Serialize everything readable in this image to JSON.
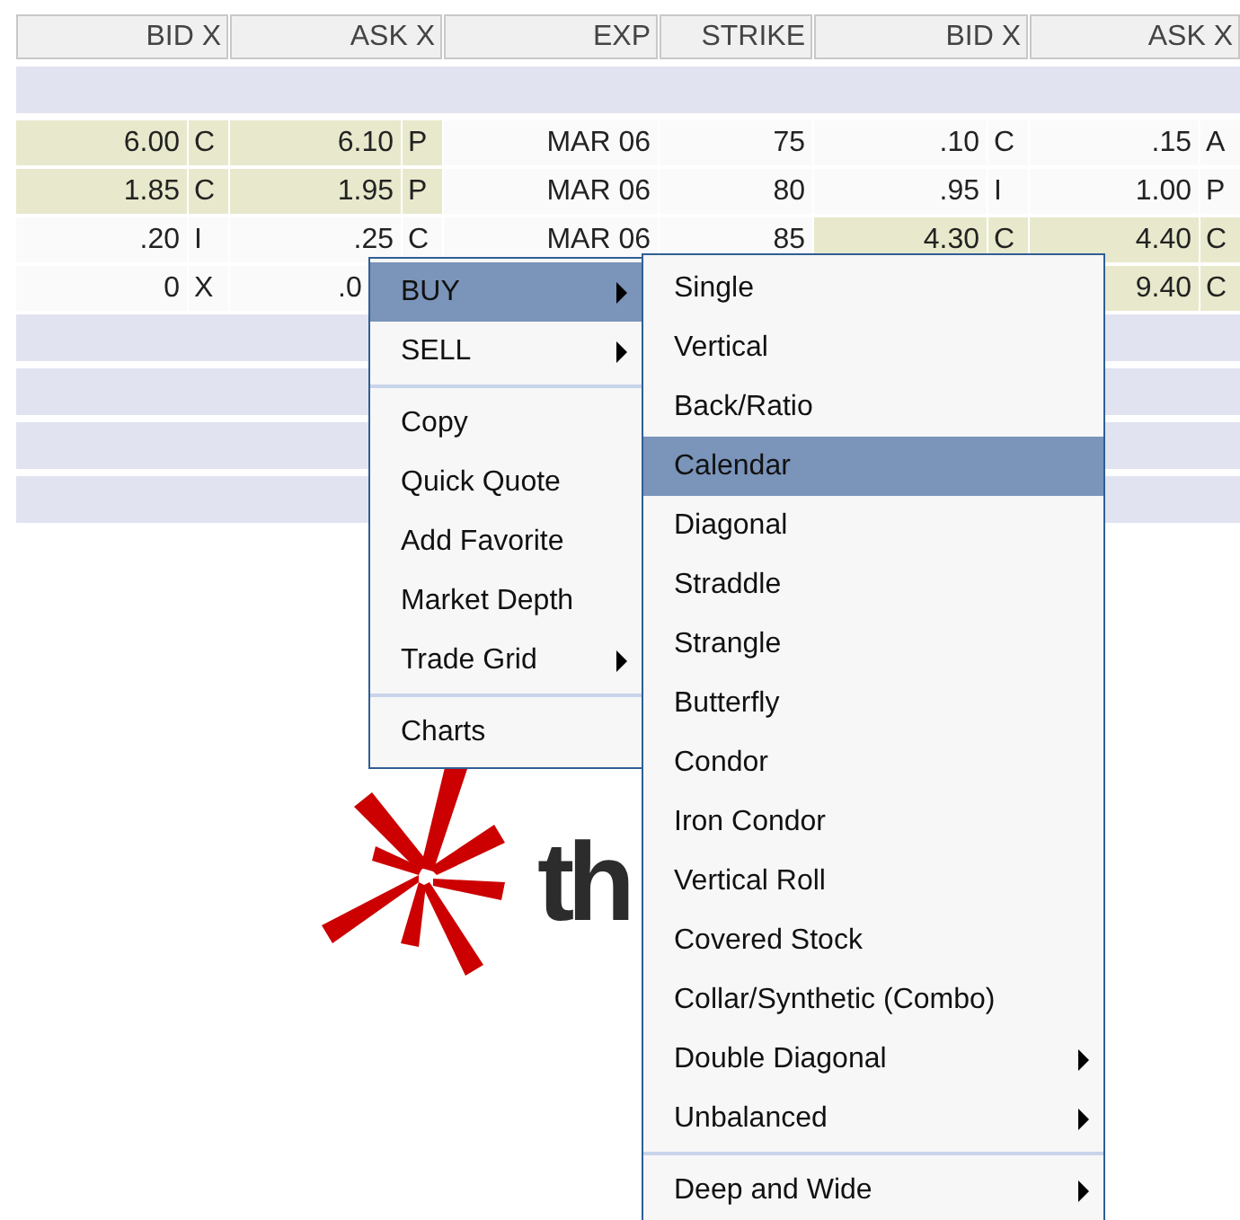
{
  "table": {
    "columns": [
      "BID X",
      "ASK X",
      "EXP",
      "STRIKE",
      "BID X",
      "ASK X"
    ],
    "rows": [
      {
        "kind": "blank"
      },
      {
        "kind": "quote",
        "cells": [
          {
            "text": "6.00",
            "highlighted": true
          },
          {
            "text": "C",
            "highlighted": true
          },
          {
            "text": "6.10",
            "highlighted": true
          },
          {
            "text": "P",
            "highlighted": true
          },
          {
            "text": "MAR 06",
            "highlighted": false
          },
          {
            "text": "75",
            "highlighted": false
          },
          {
            "text": ".10",
            "highlighted": false
          },
          {
            "text": "C",
            "highlighted": false
          },
          {
            "text": ".15",
            "highlighted": false
          },
          {
            "text": "A",
            "highlighted": false
          }
        ]
      },
      {
        "kind": "quote",
        "cells": [
          {
            "text": "1.85",
            "highlighted": true
          },
          {
            "text": "C",
            "highlighted": true
          },
          {
            "text": "1.95",
            "highlighted": true
          },
          {
            "text": "P",
            "highlighted": true
          },
          {
            "text": "MAR 06",
            "highlighted": false
          },
          {
            "text": "80",
            "highlighted": false
          },
          {
            "text": ".95",
            "highlighted": false
          },
          {
            "text": "I",
            "highlighted": false
          },
          {
            "text": "1.00",
            "highlighted": false
          },
          {
            "text": "P",
            "highlighted": false
          }
        ]
      },
      {
        "kind": "quote",
        "cells": [
          {
            "text": ".20",
            "highlighted": false
          },
          {
            "text": "I",
            "highlighted": false
          },
          {
            "text": ".25",
            "highlighted": false
          },
          {
            "text": "C",
            "highlighted": false
          },
          {
            "text": "MAR 06",
            "highlighted": false
          },
          {
            "text": "85",
            "highlighted": false
          },
          {
            "text": "4.30",
            "highlighted": true
          },
          {
            "text": "C",
            "highlighted": true
          },
          {
            "text": "4.40",
            "highlighted": true
          },
          {
            "text": "C",
            "highlighted": true
          }
        ]
      },
      {
        "kind": "quote",
        "cells": [
          {
            "text": "0",
            "highlighted": false
          },
          {
            "text": "X",
            "highlighted": false
          },
          {
            "text": ".0",
            "highlighted": false
          },
          null,
          null,
          null,
          null,
          null,
          {
            "text": "9.40",
            "highlighted": true
          },
          {
            "text": "C",
            "highlighted": true
          }
        ]
      },
      {
        "kind": "blank"
      },
      {
        "kind": "blank"
      },
      {
        "kind": "blank"
      },
      {
        "kind": "blank"
      }
    ]
  },
  "logo": {
    "text": "th"
  },
  "menu": {
    "items": [
      {
        "kind": "item",
        "label": "BUY",
        "submenu": true,
        "selected": true
      },
      {
        "kind": "item",
        "label": "SELL",
        "submenu": true,
        "selected": false
      },
      {
        "kind": "separator"
      },
      {
        "kind": "item",
        "label": "Copy",
        "submenu": false,
        "selected": false
      },
      {
        "kind": "item",
        "label": "Quick Quote",
        "submenu": false,
        "selected": false
      },
      {
        "kind": "item",
        "label": "Add Favorite",
        "submenu": false,
        "selected": false
      },
      {
        "kind": "item",
        "label": "Market Depth",
        "submenu": false,
        "selected": false
      },
      {
        "kind": "item",
        "label": "Trade Grid",
        "submenu": true,
        "selected": false
      },
      {
        "kind": "separator"
      },
      {
        "kind": "item",
        "label": "Charts",
        "submenu": false,
        "selected": false
      }
    ]
  },
  "submenu": {
    "items": [
      {
        "kind": "item",
        "label": "Single",
        "submenu": false,
        "selected": false
      },
      {
        "kind": "item",
        "label": "Vertical",
        "submenu": false,
        "selected": false
      },
      {
        "kind": "item",
        "label": "Back/Ratio",
        "submenu": false,
        "selected": false
      },
      {
        "kind": "item",
        "label": "Calendar",
        "submenu": false,
        "selected": true
      },
      {
        "kind": "item",
        "label": "Diagonal",
        "submenu": false,
        "selected": false
      },
      {
        "kind": "item",
        "label": "Straddle",
        "submenu": false,
        "selected": false
      },
      {
        "kind": "item",
        "label": "Strangle",
        "submenu": false,
        "selected": false
      },
      {
        "kind": "item",
        "label": "Butterfly",
        "submenu": false,
        "selected": false
      },
      {
        "kind": "item",
        "label": "Condor",
        "submenu": false,
        "selected": false
      },
      {
        "kind": "item",
        "label": "Iron Condor",
        "submenu": false,
        "selected": false
      },
      {
        "kind": "item",
        "label": "Vertical Roll",
        "submenu": false,
        "selected": false
      },
      {
        "kind": "item",
        "label": "Covered Stock",
        "submenu": false,
        "selected": false
      },
      {
        "kind": "item",
        "label": "Collar/Synthetic (Combo)",
        "submenu": false,
        "selected": false
      },
      {
        "kind": "item",
        "label": "Double Diagonal",
        "submenu": true,
        "selected": false
      },
      {
        "kind": "item",
        "label": "Unbalanced",
        "submenu": true,
        "selected": false
      },
      {
        "kind": "separator"
      },
      {
        "kind": "item",
        "label": "Deep and Wide",
        "submenu": true,
        "selected": false
      }
    ]
  }
}
